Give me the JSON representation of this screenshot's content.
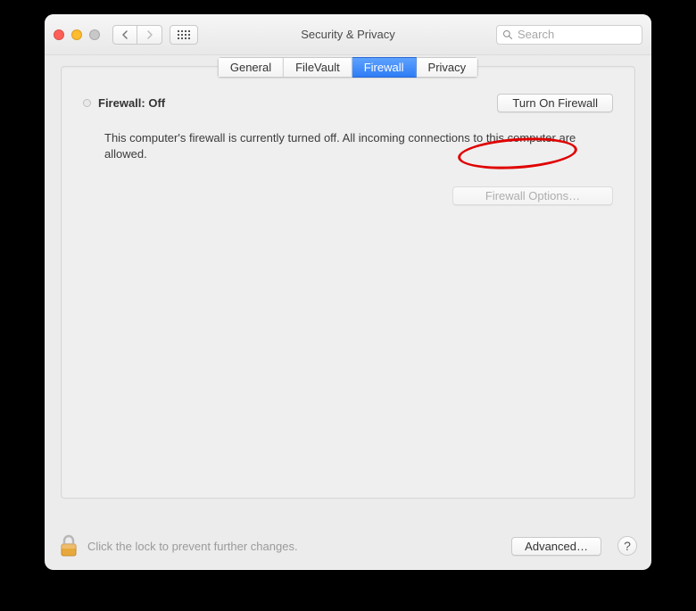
{
  "window": {
    "title": "Security & Privacy"
  },
  "search": {
    "placeholder": "Search"
  },
  "tabs": [
    {
      "label": "General",
      "active": false
    },
    {
      "label": "FileVault",
      "active": false
    },
    {
      "label": "Firewall",
      "active": true
    },
    {
      "label": "Privacy",
      "active": false
    }
  ],
  "firewall": {
    "status_label": "Firewall: Off",
    "toggle_button": "Turn On Firewall",
    "description": "This computer's firewall is currently turned off. All incoming connections to this computer are allowed.",
    "options_button": "Firewall Options…"
  },
  "footer": {
    "lock_text": "Click the lock to prevent further changes.",
    "advanced_button": "Advanced…",
    "help": "?"
  }
}
